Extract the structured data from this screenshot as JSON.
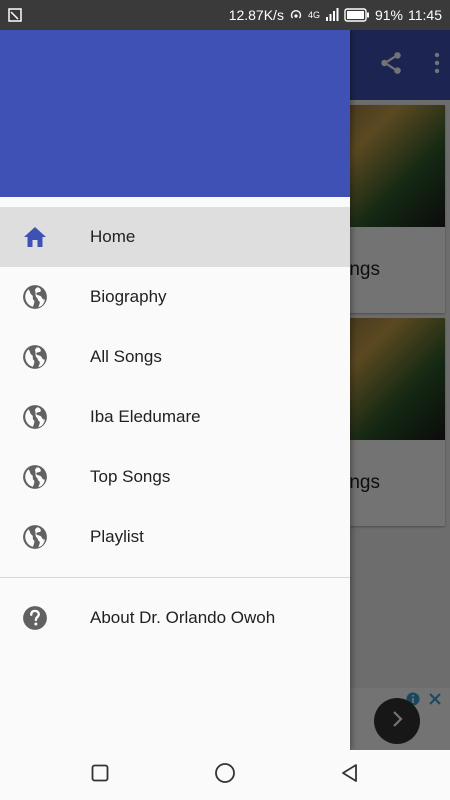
{
  "status_bar": {
    "speed": "12.87K/s",
    "network": "4G",
    "battery": "91%",
    "time": "11:45"
  },
  "app": {
    "cards": [
      {
        "title_fragment": "ngs"
      },
      {
        "title_fragment": "ngs"
      }
    ]
  },
  "drawer": {
    "items": [
      {
        "label": "Home",
        "icon": "home-icon",
        "active": true
      },
      {
        "label": "Biography",
        "icon": "globe-icon"
      },
      {
        "label": "All Songs",
        "icon": "globe-icon"
      },
      {
        "label": "Iba Eledumare",
        "icon": "globe-icon"
      },
      {
        "label": "Top Songs",
        "icon": "globe-icon"
      },
      {
        "label": "Playlist",
        "icon": "globe-icon"
      }
    ],
    "about": {
      "label": "About Dr. Orlando Owoh",
      "icon": "help-icon"
    }
  },
  "colors": {
    "primary": "#3f51b5",
    "active_item_bg": "#dedede",
    "icon_gray": "#616161"
  }
}
